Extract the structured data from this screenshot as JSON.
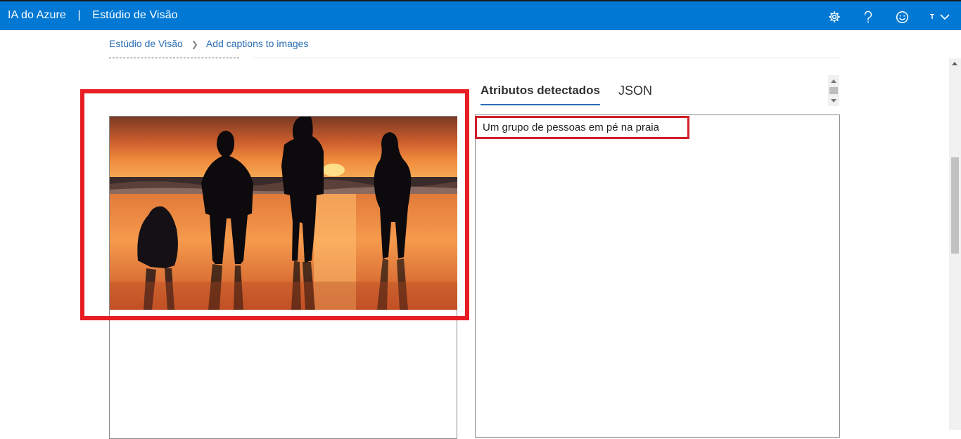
{
  "header": {
    "brand": "IA do Azure",
    "separator": "|",
    "app_title": "Estúdio de Visão",
    "user_initial": "T"
  },
  "breadcrumb": {
    "home": "Estúdio de Visão",
    "current": "Add captions to images"
  },
  "tabs": {
    "attributes": "Atributos detectados",
    "json": "JSON"
  },
  "result": {
    "caption": "Um grupo de pessoas em pé na praia"
  },
  "colors": {
    "header_bg": "#0078d4",
    "highlight": "#e81d24",
    "link": "#2a6db3"
  }
}
